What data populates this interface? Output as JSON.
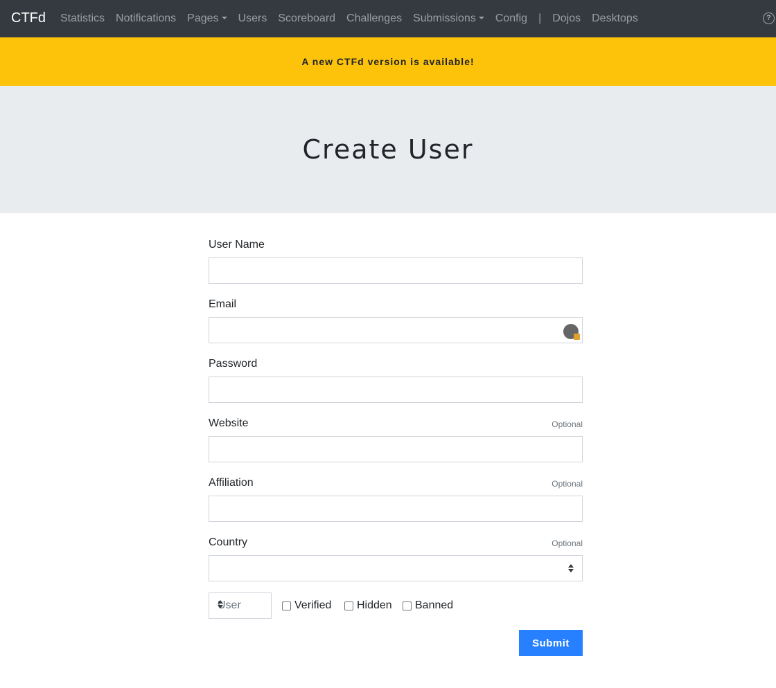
{
  "navbar": {
    "brand": "CTFd",
    "items": [
      {
        "label": "Statistics"
      },
      {
        "label": "Notifications"
      },
      {
        "label": "Pages",
        "dropdown": true
      },
      {
        "label": "Users"
      },
      {
        "label": "Scoreboard"
      },
      {
        "label": "Challenges"
      },
      {
        "label": "Submissions",
        "dropdown": true
      },
      {
        "label": "Config"
      }
    ],
    "separator": "|",
    "extra_items": [
      {
        "label": "Dojos"
      },
      {
        "label": "Desktops"
      }
    ],
    "help_icon": "question-circle-icon"
  },
  "banner": {
    "text": "A new CTFd version is available!",
    "color": "#fcc30a"
  },
  "page": {
    "title": "Create User"
  },
  "form": {
    "fields": [
      {
        "label": "User Name",
        "value": "",
        "optional_label": ""
      },
      {
        "label": "Email",
        "value": "",
        "optional_label": ""
      },
      {
        "label": "Password",
        "value": "",
        "optional_label": ""
      },
      {
        "label": "Website",
        "value": "",
        "optional_label": "Optional"
      },
      {
        "label": "Affiliation",
        "value": "",
        "optional_label": "Optional"
      },
      {
        "label": "Country",
        "value": "",
        "optional_label": "Optional"
      }
    ],
    "role": {
      "value": "User"
    },
    "checkboxes": [
      {
        "label": "Verified",
        "checked": false
      },
      {
        "label": "Hidden",
        "checked": false
      },
      {
        "label": "Banned",
        "checked": false
      }
    ],
    "submit_label": "Submit"
  },
  "colors": {
    "navbar": "#343a40",
    "jumbotron": "#e9ecef",
    "primary_button": "#2680ff"
  }
}
